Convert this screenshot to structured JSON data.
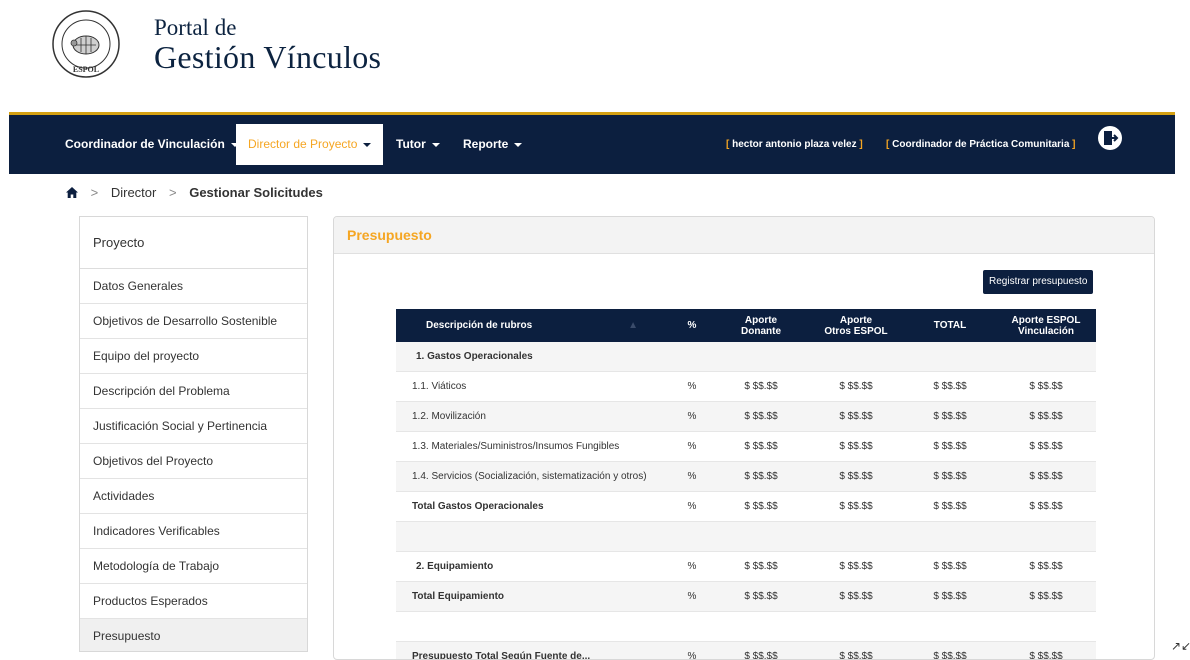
{
  "header": {
    "line1": "Portal de",
    "line2": "Gestión Vínculos",
    "logo_text": "ESPOL"
  },
  "nav": {
    "items": [
      {
        "label": "Coordinador de Vinculación"
      },
      {
        "label": "Director de Proyecto"
      },
      {
        "label": "Tutor"
      },
      {
        "label": "Reporte"
      }
    ],
    "user_name": "hector antonio plaza velez",
    "user_role": "Coordinador de Práctica Comunitaria",
    "bracket_open": "[",
    "bracket_close": "]",
    "logout_icon": "logout-icon"
  },
  "breadcrumb": {
    "home_icon": "home-icon",
    "separator": ">",
    "items": [
      "Director",
      "Gestionar Solicitudes"
    ]
  },
  "sidebar": {
    "title": "Proyecto",
    "items": [
      {
        "label": "Datos Generales"
      },
      {
        "label": "Objetivos de Desarrollo Sostenible"
      },
      {
        "label": "Equipo del proyecto"
      },
      {
        "label": "Descripción del Problema"
      },
      {
        "label": "Justificación Social y Pertinencia"
      },
      {
        "label": "Objetivos del Proyecto"
      },
      {
        "label": "Actividades"
      },
      {
        "label": "Indicadores Verificables"
      },
      {
        "label": "Metodología de Trabajo"
      },
      {
        "label": "Productos Esperados"
      },
      {
        "label": "Presupuesto",
        "active": true
      }
    ]
  },
  "panel": {
    "title": "Presupuesto",
    "register_button": "Registrar presupuesto"
  },
  "table": {
    "headers": {
      "desc": "Descripción de rubros",
      "pct": "%",
      "donante_l1": "Aporte",
      "donante_l2": "Donante",
      "otros_l1": "Aporte",
      "otros_l2": "Otros ESPOL",
      "total": "TOTAL",
      "vinc_l1": "Aporte ESPOL",
      "vinc_l2": "Vinculación"
    },
    "rows": [
      {
        "kind": "section",
        "desc": "1. Gastos Operacionales",
        "cells": [
          "",
          "",
          "",
          "",
          ""
        ]
      },
      {
        "kind": "item",
        "desc": "1.1. Viáticos",
        "cells": [
          "%",
          "$ $$.$$",
          "$ $$.$$",
          "$ $$.$$",
          "$ $$.$$"
        ]
      },
      {
        "kind": "item",
        "desc": "1.2. Movilización",
        "cells": [
          "%",
          "$ $$.$$",
          "$ $$.$$",
          "$ $$.$$",
          "$ $$.$$"
        ]
      },
      {
        "kind": "item",
        "desc": "1.3. Materiales/Suministros/Insumos Fungibles",
        "cells": [
          "%",
          "$ $$.$$",
          "$ $$.$$",
          "$ $$.$$",
          "$ $$.$$"
        ]
      },
      {
        "kind": "item",
        "desc": "1.4. Servicios (Socialización, sistematización y otros)",
        "cells": [
          "%",
          "$ $$.$$",
          "$ $$.$$",
          "$ $$.$$",
          "$ $$.$$"
        ]
      },
      {
        "kind": "total",
        "desc": "Total Gastos Operacionales",
        "cells": [
          "%",
          "$ $$.$$",
          "$ $$.$$",
          "$ $$.$$",
          "$ $$.$$"
        ]
      },
      {
        "kind": "blank",
        "desc": "",
        "cells": [
          "",
          "",
          "",
          "",
          ""
        ]
      },
      {
        "kind": "section",
        "desc": "2. Equipamiento",
        "cells": [
          "%",
          "$ $$.$$",
          "$ $$.$$",
          "$ $$.$$",
          "$ $$.$$"
        ]
      },
      {
        "kind": "total",
        "desc": "Total Equipamiento",
        "cells": [
          "%",
          "$ $$.$$",
          "$ $$.$$",
          "$ $$.$$",
          "$ $$.$$"
        ]
      },
      {
        "kind": "blank",
        "desc": "",
        "cells": [
          "",
          "",
          "",
          "",
          ""
        ]
      },
      {
        "kind": "total",
        "desc": "Presupuesto Total Según Fuente de...",
        "cells": [
          "%",
          "$ $$.$$",
          "$ $$.$$",
          "$ $$.$$",
          "$ $$.$$"
        ]
      }
    ]
  },
  "colors": {
    "navy": "#0c1f3f",
    "accent": "#f5a623",
    "gold_border": "#d4a012"
  }
}
